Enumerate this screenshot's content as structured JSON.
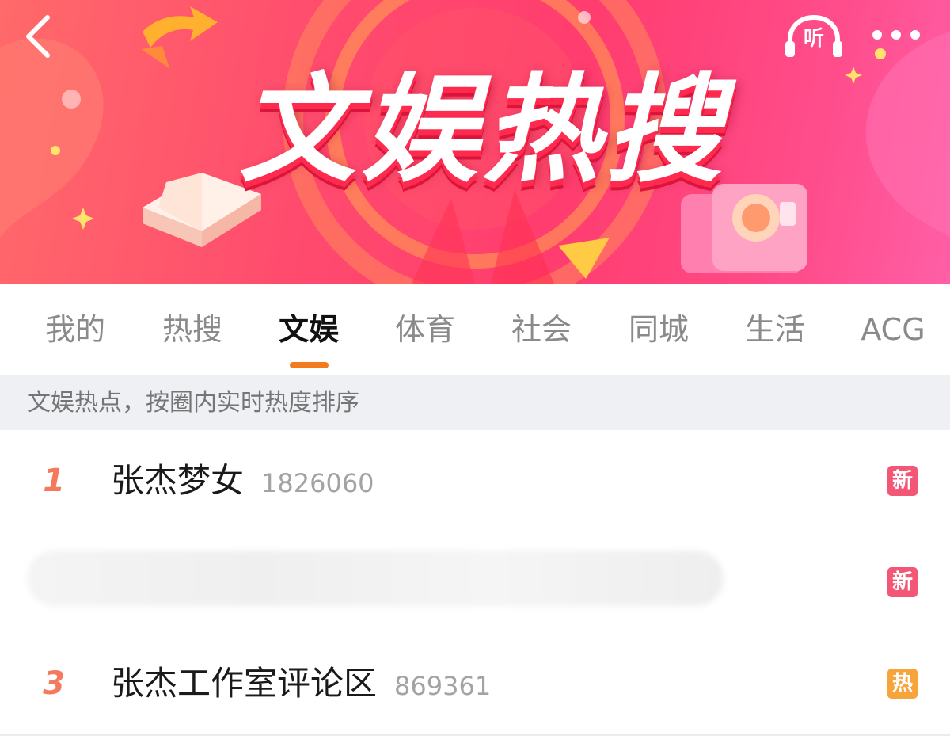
{
  "banner": {
    "title": "文娱热搜",
    "listen_label": "听"
  },
  "tabs": [
    {
      "label": "我的"
    },
    {
      "label": "热搜"
    },
    {
      "label": "文娱",
      "active": true
    },
    {
      "label": "体育"
    },
    {
      "label": "社会"
    },
    {
      "label": "同城"
    },
    {
      "label": "生活"
    },
    {
      "label": "ACG"
    }
  ],
  "subheader": {
    "text": "文娱热点，按圈内实时热度排序"
  },
  "items": [
    {
      "rank": "1",
      "title": "张杰梦女",
      "count": "1826060",
      "badge": "新"
    },
    {
      "rank": "",
      "title": "",
      "count": "",
      "badge": "新",
      "obscured": true
    },
    {
      "rank": "3",
      "title": "张杰工作室评论区",
      "count": "869361",
      "badge": "热"
    }
  ],
  "colors": {
    "accent_underline": "#f47a1f",
    "rank": "#f5795d",
    "badge_new": "#f35775",
    "badge_hot": "#f7a43b",
    "banner_primary": "#ff4a6e"
  },
  "icons": [
    "chevron-left-icon",
    "headphones-icon",
    "more-dots-icon",
    "book-icon",
    "camera-icon",
    "arrow-icon"
  ]
}
